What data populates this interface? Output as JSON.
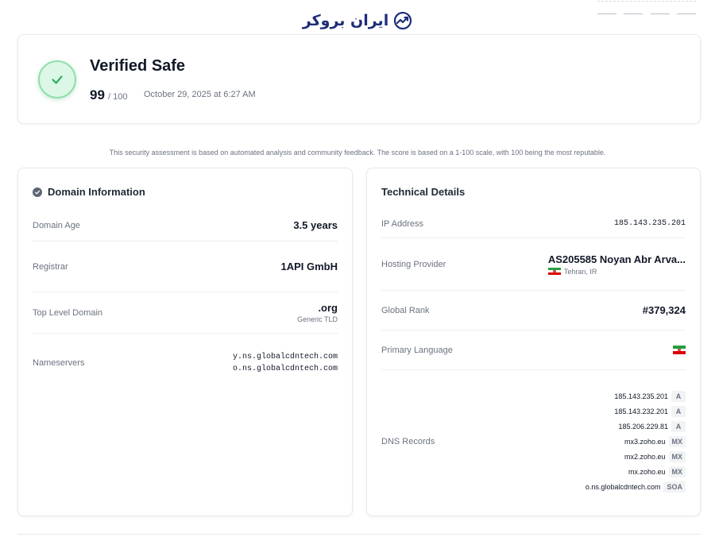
{
  "brand": {
    "logo_text": "ایران بروکر",
    "logo_icon": "trend-chart-icon"
  },
  "hero": {
    "status_title": "Verified Safe",
    "score": "99",
    "score_max": "/ 100",
    "date": "October 29, 2025 at 6:27 AM",
    "status_icon": "check-icon",
    "status_color": "#2eaa5f"
  },
  "disclaimer": "This security assessment is based on automated analysis and community feedback. The score is based on a 1-100 scale, with 100 being the most reputable.",
  "domain_info": {
    "title": "Domain Information",
    "age_label": "Domain Age",
    "age_value": "3.5 years",
    "registrar_label": "Registrar",
    "registrar_value": "1API GmbH",
    "tld_label": "Top Level Domain",
    "tld_value": ".org",
    "tld_sub": "Generic TLD",
    "ns_label": "Nameservers",
    "nameservers": [
      "y.ns.globalcdntech.com",
      "o.ns.globalcdntech.com"
    ]
  },
  "technical": {
    "title": "Technical Details",
    "ip_label": "IP Address",
    "ip_value": "185.143.235.201",
    "host_label": "Hosting Provider",
    "host_value": "AS205585 Noyan Abr Arva...",
    "host_location": "Tehran, IR",
    "rank_label": "Global Rank",
    "rank_value": "#379,324",
    "lang_label": "Primary Language",
    "dns_label": "DNS Records",
    "dns_records": [
      {
        "value": "185.143.235.201",
        "type": "A"
      },
      {
        "value": "185.143.232.201",
        "type": "A"
      },
      {
        "value": "185.206.229.81",
        "type": "A"
      },
      {
        "value": "mx3.zoho.eu",
        "type": "MX"
      },
      {
        "value": "mx2.zoho.eu",
        "type": "MX"
      },
      {
        "value": "mx.zoho.eu",
        "type": "MX"
      },
      {
        "value": "o.ns.globalcdntech.com",
        "type": "SOA"
      }
    ]
  }
}
